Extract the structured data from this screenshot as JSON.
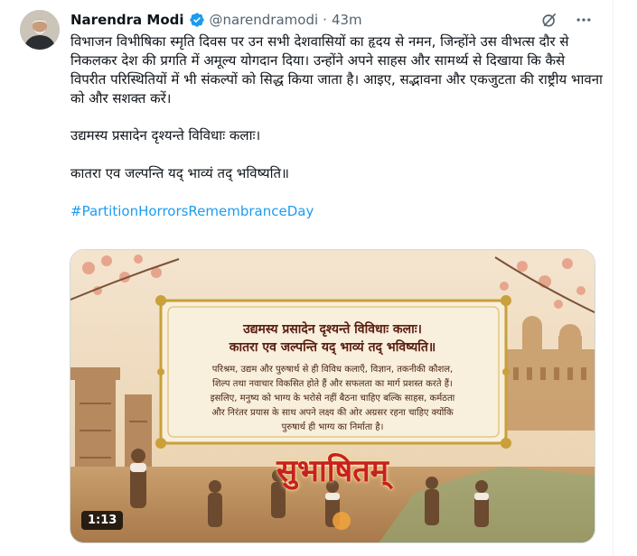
{
  "post": {
    "author": "Narendra Modi",
    "handle": "@narendramodi",
    "dot": "·",
    "time": "43m",
    "paragraph1": "विभाजन विभीषिका स्मृति दिवस पर उन सभी देशवासियों का हृदय से नमन, जिन्होंने उस वीभत्स दौर से निकलकर देश की प्रगति में अमूल्य योगदान दिया। उन्होंने अपने साहस और सामर्थ्य से दिखाया कि कैसे विपरीत परिस्थितियों में भी संकल्पों को सिद्ध किया जाता है। आइए, सद्भावना और एकजुटता की राष्ट्रीय भावना को और सशक्त करें।",
    "paragraph2": "उद्यमस्य प्रसादेन दृश्यन्ते विविधाः कलाः।",
    "paragraph3": "कातरा एव जल्पन्ति यद् भाव्यं तद् भविष्यति॥",
    "hashtag": "#PartitionHorrorsRemembranceDay"
  },
  "media": {
    "type": "video",
    "duration": "1:13",
    "verse_line1": "उद्यमस्य प्रसादेन दृश्यन्ते विविधाः कलाः।",
    "verse_line2": "कातरा एव जल्पन्ति यद् भाव्यं तद् भविष्यति॥",
    "meaning_line1": "परिश्रम, उद्यम और पुरुषार्थ से ही विविध कलाएँ, विज्ञान, तकनीकी कौशल,",
    "meaning_line2": "शिल्प तथा नवाचार विकसित होते हैं और सफलता का मार्ग प्रशस्त करते हैं।",
    "meaning_line3": "इसलिए, मनुष्य को भाग्य के भरोसे नहीं बैठना चाहिए बल्कि साहस, कर्मठता",
    "meaning_line4": "और निरंतर प्रयास के साथ अपने लक्ष्य की ओर अग्रसर रहना चाहिए क्योंकि",
    "meaning_line5": "पुरुषार्थ ही भाग्य का निर्माता है।",
    "title": "सुभाषितम्"
  },
  "icons": {
    "verified": "verified-badge-icon",
    "grok": "grok-icon",
    "more": "more-icon"
  },
  "colors": {
    "link": "#1d9bf0",
    "verified": "#1d9bf0",
    "secondary": "#536471",
    "title_red": "#c8201e",
    "frame_gold": "#c9a03a"
  }
}
